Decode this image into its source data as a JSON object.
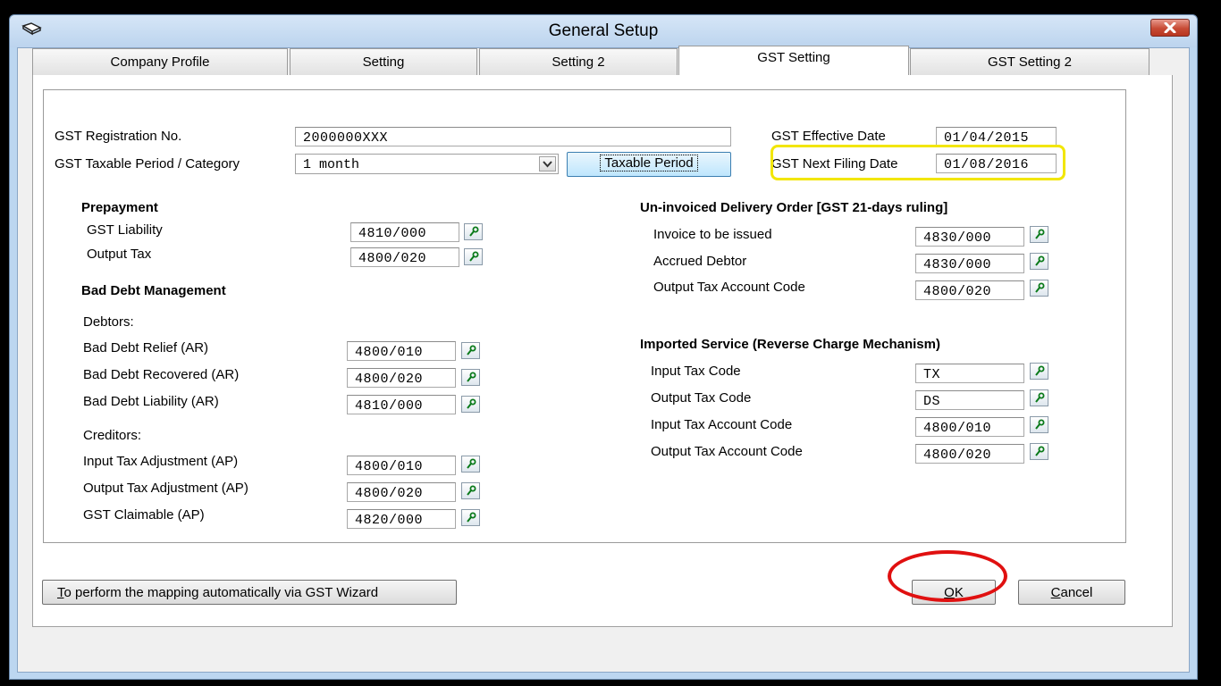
{
  "window": {
    "title": "General Setup"
  },
  "tabs": [
    {
      "label": "Company Profile"
    },
    {
      "label": "Setting"
    },
    {
      "label": "Setting 2"
    },
    {
      "label": "GST Setting"
    },
    {
      "label": "GST Setting 2"
    }
  ],
  "active_tab": "GST Setting",
  "gst": {
    "reg_label": "GST Registration No.",
    "reg_value": "2000000XXX",
    "period_label": "GST Taxable Period / Category",
    "period_value": "1 month",
    "taxable_period_button": "Taxable Period",
    "effective_date_label": "GST Effective Date",
    "effective_date_value": "01/04/2015",
    "next_filing_label": "GST Next Filing Date",
    "next_filing_value": "01/08/2016"
  },
  "prepayment": {
    "header": "Prepayment",
    "items": [
      {
        "label": "GST Liability",
        "value": "4810/000"
      },
      {
        "label": "Output Tax",
        "value": "4800/020"
      }
    ]
  },
  "bad_debt": {
    "header": "Bad Debt Management",
    "debtors_label": "Debtors:",
    "debtors": [
      {
        "label": "Bad Debt Relief (AR)",
        "value": "4800/010"
      },
      {
        "label": "Bad Debt Recovered (AR)",
        "value": "4800/020"
      },
      {
        "label": "Bad Debt Liability (AR)",
        "value": "4810/000"
      }
    ],
    "creditors_label": "Creditors:",
    "creditors": [
      {
        "label": "Input Tax Adjustment (AP)",
        "value": "4800/010"
      },
      {
        "label": "Output Tax Adjustment (AP)",
        "value": "4800/020"
      },
      {
        "label": "GST Claimable (AP)",
        "value": "4820/000"
      }
    ]
  },
  "uninvoiced": {
    "header": "Un-invoiced Delivery Order [GST 21-days ruling]",
    "items": [
      {
        "label": "Invoice to be issued",
        "value": "4830/000"
      },
      {
        "label": "Accrued Debtor",
        "value": "4830/000"
      },
      {
        "label": "Output Tax Account Code",
        "value": "4800/020"
      }
    ]
  },
  "imported": {
    "header": "Imported Service (Reverse Charge Mechanism)",
    "items": [
      {
        "label": "Input Tax Code",
        "value": "TX"
      },
      {
        "label": "Output Tax Code",
        "value": "DS"
      },
      {
        "label": "Input Tax Account Code",
        "value": "4800/010"
      },
      {
        "label": "Output Tax Account Code",
        "value": "4800/020"
      }
    ]
  },
  "footer": {
    "wizard_prefix": "T",
    "wizard_rest": "o perform the mapping automatically via GST Wizard",
    "ok_prefix": "O",
    "ok_rest": "K",
    "cancel_prefix": "C",
    "cancel_rest": "ancel"
  },
  "icons": {
    "app": "book-icon",
    "close": "close-icon",
    "lookup": "lookup-key-icon",
    "dropdown": "chevron-down-icon"
  },
  "colors": {
    "highlight_yellow": "#f2e600",
    "highlight_red": "#e01010",
    "close_button": "#c74a35"
  }
}
